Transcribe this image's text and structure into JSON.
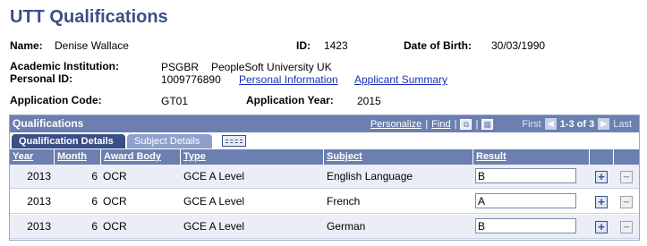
{
  "page": {
    "title": "UTT Qualifications"
  },
  "person": {
    "name_label": "Name:",
    "name": "Denise Wallace",
    "id_label": "ID:",
    "id": "1423",
    "dob_label": "Date of Birth:",
    "dob": "30/03/1990",
    "institution_label": "Academic Institution:",
    "institution_code": "PSGBR",
    "institution_name": "PeopleSoft University UK",
    "personal_id_label": "Personal ID:",
    "personal_id": "1009776890",
    "personal_info_link": "Personal Information",
    "applicant_summary_link": "Applicant Summary",
    "app_code_label": "Application Code:",
    "app_code": "GT01",
    "app_year_label": "Application Year:",
    "app_year": "2015"
  },
  "grid": {
    "title": "Qualifications",
    "personalize": "Personalize",
    "find": "Find",
    "sep": "|",
    "first": "First",
    "range": "1-3 of 3",
    "last": "Last",
    "tabs": [
      "Qualification Details",
      "Subject Details"
    ],
    "columns": [
      "Year",
      "Month",
      "Award Body",
      "Type",
      "Subject",
      "Result"
    ],
    "rows": [
      {
        "year": "2013",
        "month": "6",
        "award_body": "OCR",
        "type": "GCE A Level",
        "subject": "English Language",
        "result": "B"
      },
      {
        "year": "2013",
        "month": "6",
        "award_body": "OCR",
        "type": "GCE A Level",
        "subject": "French",
        "result": "A"
      },
      {
        "year": "2013",
        "month": "6",
        "award_body": "OCR",
        "type": "GCE A Level",
        "subject": "German",
        "result": "B"
      }
    ],
    "add_symbol": "+",
    "delete_symbol": "−"
  },
  "icons": {
    "grid_view": "grid-view-icon",
    "download": "download-icon",
    "prev": "prev-arrow-icon",
    "next": "next-arrow-icon",
    "show_all_columns": "show-all-columns-icon"
  },
  "colors": {
    "title": "#3a4f87",
    "header_bg": "#6b7fb0",
    "active_tab": "#3a4f87",
    "inactive_tab": "#8fa0cc",
    "link": "#1c2fb5"
  }
}
